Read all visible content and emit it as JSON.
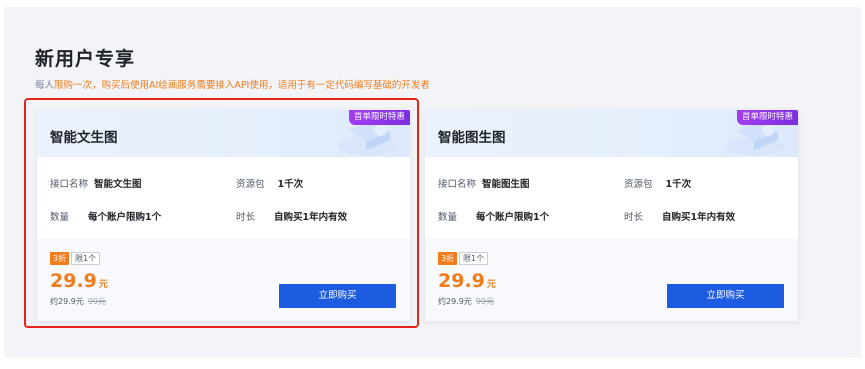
{
  "section": {
    "title": "新用户专享",
    "subtitle_prefix": "每人",
    "subtitle_highlight": "限购一次，购买后使用AI绘画服务需要接入API使用，适用于有一定代码编写基础的开发者"
  },
  "cards": [
    {
      "title": "智能文生图",
      "badge": "首单限时特惠",
      "api_label": "接口名称",
      "api_value": "智能文生图",
      "package_label": "资源包",
      "package_value": "1千次",
      "quantity_label": "数量",
      "quantity_value": "每个账户限购1个",
      "duration_label": "时长",
      "duration_value": "自购买1年内有效",
      "discount": "3折",
      "limit": "限1个",
      "price": "29.9",
      "price_unit": "元",
      "price_approx": "约29.9元",
      "price_original": "99元",
      "buy_label": "立即购买"
    },
    {
      "title": "智能图生图",
      "badge": "首单限时特惠",
      "api_label": "接口名称",
      "api_value": "智能图生图",
      "package_label": "资源包",
      "package_value": "1千次",
      "quantity_label": "数量",
      "quantity_value": "每个账户限购1个",
      "duration_label": "时长",
      "duration_value": "自购买1年内有效",
      "discount": "3折",
      "limit": "限1个",
      "price": "29.9",
      "price_unit": "元",
      "price_approx": "约29.9元",
      "price_original": "99元",
      "buy_label": "立即购买"
    }
  ],
  "colors": {
    "accent_orange": "#f07c1b",
    "button_blue": "#1d5be0",
    "badge_purple": "#8a33e6",
    "highlight_red": "#e1251b"
  }
}
